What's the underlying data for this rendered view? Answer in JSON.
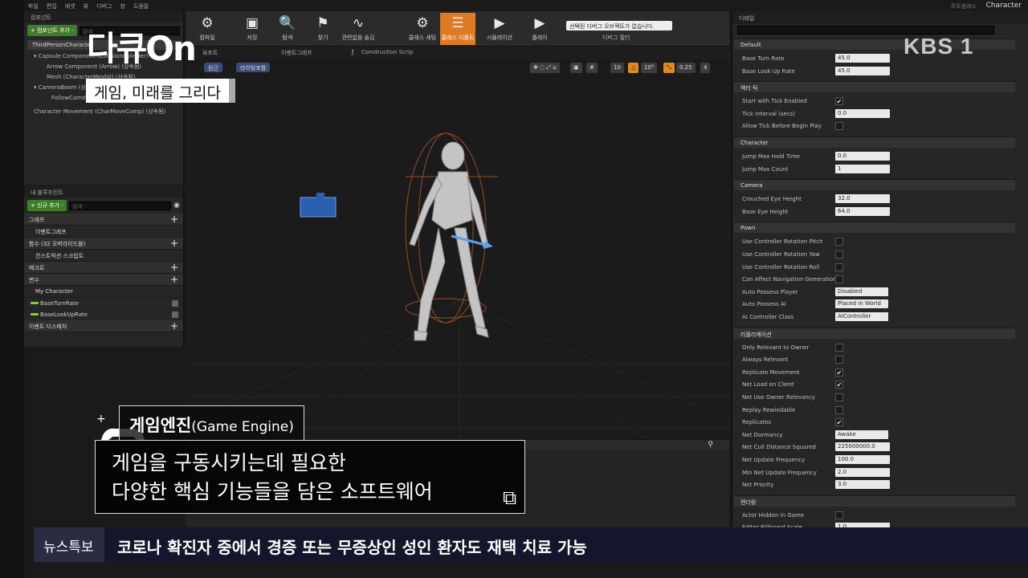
{
  "menubar": [
    "파일",
    "편집",
    "애셋",
    "뷰",
    "디버그",
    "창",
    "도움말"
  ],
  "topright": {
    "sub": "루토블래스",
    "title": "Character"
  },
  "components": {
    "tab": "컴포넌트",
    "add_label": "+ 컴포넌트 추가 -",
    "search_placeholder": "검색",
    "self_item": "ThirdPersonCharacter",
    "tree": [
      "▾ Capsule Component (CollisionCylinder)",
      "Arrow Component (Arrow) (상속됨)",
      "Mesh (CharacterMesh0) (상속됨)",
      "▾ CameraBoom (상속됨)",
      "FollowCamera",
      "Character Movement (CharMoveComp) (상속됨)"
    ]
  },
  "blueprint": {
    "tab": "내 블루프린트",
    "add_label": "+ 신규 추가 -",
    "search_placeholder": "검색",
    "sections": [
      {
        "label": "그래프",
        "plus": "+"
      },
      {
        "label": "이벤트그래프",
        "plus": ""
      },
      {
        "label": "함수 (32 오버라이드블)",
        "plus": "+"
      },
      {
        "label": "컨스트럭션 스크립트",
        "plus": ""
      },
      {
        "label": "매크로",
        "plus": "+"
      },
      {
        "label": "변수",
        "plus": "+"
      },
      {
        "label": "My Character",
        "plus": ""
      }
    ],
    "variables": [
      "BaseTurnRate",
      "BaseLookUpRate"
    ],
    "dispatchers": {
      "label": "이벤트 디스패처",
      "plus": "+"
    }
  },
  "toolbar": {
    "buttons": [
      {
        "label": "컴파일",
        "icon": "⚙"
      },
      {
        "label": "저장",
        "icon": "▣"
      },
      {
        "label": "탐색",
        "icon": "🔍"
      },
      {
        "label": "찾기",
        "icon": "⚑"
      },
      {
        "label": "관련없음 숨김",
        "icon": "∿"
      },
      {
        "label": "클래스 세팅",
        "icon": "⚙"
      },
      {
        "label": "클래스 디폴트",
        "icon": "☰"
      },
      {
        "label": "시뮬레이션",
        "icon": "▶"
      },
      {
        "label": "플레이",
        "icon": "▶"
      }
    ],
    "debug_dropdown": "선택된 디버그 오브젝트가 없습니다.",
    "debug_label": "디버그 필터"
  },
  "tabs": [
    "뷰포트",
    "이벤트그래프",
    "Construction Scrip"
  ],
  "viewport": {
    "buttons": [
      "원근",
      "라이팅포함"
    ],
    "tools": [
      "10",
      "10°",
      "0.25",
      "4"
    ]
  },
  "details": {
    "tab": "디테일",
    "categories": [
      {
        "name": "Default",
        "rows": [
          {
            "label": "Base Turn Rate",
            "type": "val",
            "value": "45.0"
          },
          {
            "label": "Base Look Up Rate",
            "type": "val",
            "value": "45.0"
          }
        ]
      },
      {
        "name": "액터 틱",
        "rows": [
          {
            "label": "Start with Tick Enabled",
            "type": "chk",
            "value": "✔"
          },
          {
            "label": "Tick Interval (secs)",
            "type": "val",
            "value": "0.0"
          },
          {
            "label": "Allow Tick Before Begin Play",
            "type": "chk",
            "value": ""
          }
        ]
      },
      {
        "name": "Character",
        "rows": [
          {
            "label": "Jump Max Hold Time",
            "type": "val",
            "value": "0.0"
          },
          {
            "label": "Jump Max Count",
            "type": "val",
            "value": "1"
          }
        ]
      },
      {
        "name": "Camera",
        "rows": [
          {
            "label": "Crouched Eye Height",
            "type": "val",
            "value": "32.0"
          },
          {
            "label": "Base Eye Height",
            "type": "val",
            "value": "64.0"
          }
        ]
      },
      {
        "name": "Pawn",
        "rows": [
          {
            "label": "Use Controller Rotation Pitch",
            "type": "chk",
            "value": ""
          },
          {
            "label": "Use Controller Rotation Yaw",
            "type": "chk",
            "value": ""
          },
          {
            "label": "Use Controller Rotation Roll",
            "type": "chk",
            "value": ""
          },
          {
            "label": "Can Affect Navigation Generation",
            "type": "chk",
            "value": ""
          },
          {
            "label": "Auto Possess Player",
            "type": "sel",
            "value": "Disabled"
          },
          {
            "label": "Auto Possess AI",
            "type": "sel",
            "value": "Placed in World"
          },
          {
            "label": "AI Controller Class",
            "type": "sel",
            "value": "AIController"
          }
        ]
      },
      {
        "name": "리플리케이션",
        "rows": [
          {
            "label": "Only Relevant to Owner",
            "type": "chk",
            "value": ""
          },
          {
            "label": "Always Relevant",
            "type": "chk",
            "value": ""
          },
          {
            "label": "Replicate Movement",
            "type": "chk",
            "value": "✔"
          },
          {
            "label": "Net Load on Client",
            "type": "chk",
            "value": "✔"
          },
          {
            "label": "Net Use Owner Relevancy",
            "type": "chk",
            "value": ""
          },
          {
            "label": "Replay Rewindable",
            "type": "chk",
            "value": ""
          },
          {
            "label": "Replicates",
            "type": "chk",
            "value": "✔"
          },
          {
            "label": "Net Dormancy",
            "type": "sel",
            "value": "Awake"
          },
          {
            "label": "Net Cull Distance Squared",
            "type": "val",
            "value": "225000000.0"
          },
          {
            "label": "Net Update Frequency",
            "type": "val",
            "value": "100.0"
          },
          {
            "label": "Min Net Update Frequency",
            "type": "val",
            "value": "2.0"
          },
          {
            "label": "Net Priority",
            "type": "val",
            "value": "3.0"
          }
        ]
      },
      {
        "name": "렌더링",
        "rows": [
          {
            "label": "Actor Hidden in Game",
            "type": "chk",
            "value": ""
          },
          {
            "label": "Editor Billboard Scale",
            "type": "val",
            "value": "1.0"
          }
        ]
      }
    ]
  },
  "overlay": {
    "channel": "KBS 1",
    "program_logo": "다큐On",
    "program_subtitle": "게임, 미래를 그리다",
    "caption_title": "게임엔진",
    "caption_title_en": "(Game Engine)",
    "caption_line1": "게임을 구동시키는데 필요한",
    "caption_line2": "다양한 핵심 기능들을 담은 소프트웨어",
    "ticker_tag": "뉴스특보",
    "ticker_text": "코로나 확진자 중에서 경증 또는 무증상인 성인 환자도 재택 치료 가능"
  }
}
